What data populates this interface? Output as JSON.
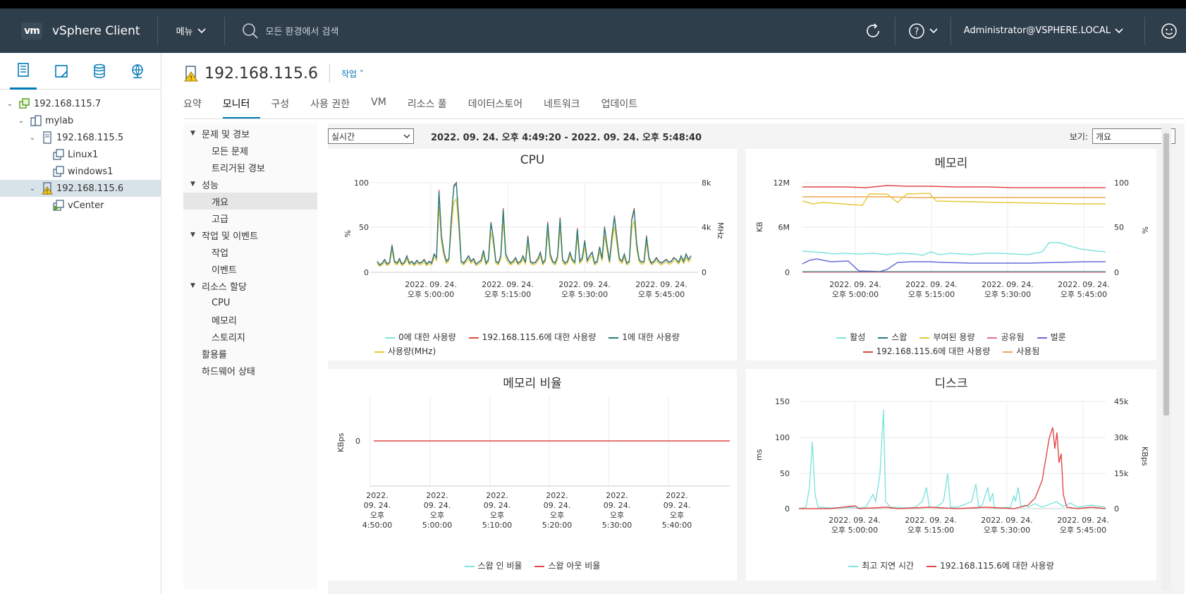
{
  "header": {
    "logo": "vm",
    "app_title": "vSphere Client",
    "menu_label": "메뉴",
    "search_placeholder": "모든 환경에서 검색",
    "user": "Administrator@VSPHERE.LOCAL"
  },
  "left_tabs": [
    "hosts-clusters-icon",
    "vms-templates-icon",
    "storage-icon",
    "networking-icon"
  ],
  "tree": [
    {
      "label": "192.168.115.7",
      "level": 0,
      "icon": "vcenter-icon",
      "expanded": true
    },
    {
      "label": "mylab",
      "level": 1,
      "icon": "datacenter-icon",
      "expanded": true
    },
    {
      "label": "192.168.115.5",
      "level": 2,
      "icon": "host-icon",
      "expanded": true
    },
    {
      "label": "Linux1",
      "level": 3,
      "icon": "vm-icon"
    },
    {
      "label": "windows1",
      "level": 3,
      "icon": "vm-icon"
    },
    {
      "label": "192.168.115.6",
      "level": 2,
      "icon": "host-warning-icon",
      "expanded": true,
      "selected": true
    },
    {
      "label": "vCenter",
      "level": 3,
      "icon": "vm-running-icon"
    }
  ],
  "page": {
    "title": "192.168.115.6",
    "actions_label": "작업",
    "tabs": [
      "요약",
      "모니터",
      "구성",
      "사용 권한",
      "VM",
      "리소스 풀",
      "데이터스토어",
      "네트워크",
      "업데이트"
    ],
    "active_tab": "모니터"
  },
  "subnav": [
    {
      "label": "문제 및 경보",
      "type": "group"
    },
    {
      "label": "모든 문제",
      "type": "child"
    },
    {
      "label": "트리거된 경보",
      "type": "child"
    },
    {
      "label": "성능",
      "type": "group"
    },
    {
      "label": "개요",
      "type": "child",
      "selected": true
    },
    {
      "label": "고급",
      "type": "child"
    },
    {
      "label": "작업 및 이벤트",
      "type": "group"
    },
    {
      "label": "작업",
      "type": "child"
    },
    {
      "label": "이벤트",
      "type": "child"
    },
    {
      "label": "리소스 할당",
      "type": "group"
    },
    {
      "label": "CPU",
      "type": "child"
    },
    {
      "label": "메모리",
      "type": "child"
    },
    {
      "label": "스토리지",
      "type": "child"
    },
    {
      "label": "활용률",
      "type": "plain"
    },
    {
      "label": "하드웨어 상태",
      "type": "plain"
    }
  ],
  "toolbar": {
    "period": "실시간",
    "range": "2022. 09. 24. 오후 4:49:20 - 2022. 09. 24. 오후 5:48:40",
    "view_label": "보기:",
    "view_value": "개요"
  },
  "colors": {
    "header_bg": "#2f3e4b",
    "accent": "#0079b8",
    "teal_light": "#7fe3e0",
    "teal_dark": "#2b7b7b",
    "yellow": "#e6c93a",
    "red": "#e04848",
    "orange": "#f0a552",
    "purple": "#6a6adc",
    "pink": "#e8708a"
  },
  "chart_data": [
    {
      "type": "line",
      "title": "CPU",
      "ylabel": "%",
      "y2label": "MHz",
      "ylim": [
        0,
        100
      ],
      "yticks": [
        "100",
        "50",
        "0"
      ],
      "y2ticks": [
        "8k",
        "4k",
        "0"
      ],
      "xticks": [
        [
          "2022. 09. 24.",
          "오후 5:00:00"
        ],
        [
          "2022. 09. 24.",
          "오후 5:15:00"
        ],
        [
          "2022. 09. 24.",
          "오후 5:30:00"
        ],
        [
          "2022. 09. 24.",
          "오후 5:45:00"
        ]
      ],
      "series": [
        {
          "name": "0에 대한 사용량",
          "color": "#7fe3e0"
        },
        {
          "name": "192.168.115.6에 대한 사용량",
          "color": "#e04848"
        },
        {
          "name": "1에 대한 사용량",
          "color": "#2b7b7b"
        },
        {
          "name": "사용량(MHz)",
          "color": "#e6c93a"
        }
      ],
      "values": [
        12,
        8,
        10,
        14,
        9,
        11,
        30,
        12,
        10,
        15,
        9,
        11,
        18,
        10,
        12,
        9,
        13,
        10,
        11,
        14,
        9,
        12,
        10,
        20,
        16,
        90,
        40,
        22,
        12,
        15,
        60,
        95,
        100,
        60,
        12,
        10,
        14,
        18,
        12,
        15,
        9,
        11,
        13,
        24,
        10,
        14,
        55,
        38,
        12,
        10,
        18,
        70,
        20,
        14,
        10,
        12,
        16,
        10,
        12,
        18,
        11,
        40,
        12,
        10,
        11,
        15,
        22,
        10,
        14,
        55,
        20,
        12,
        10,
        18,
        60,
        14,
        10,
        12,
        22,
        14,
        11,
        48,
        12,
        16,
        35,
        13,
        18,
        22,
        10,
        12,
        28,
        15,
        50,
        30,
        12,
        40,
        62,
        38,
        15,
        12,
        20,
        10,
        12,
        58,
        70,
        32,
        14,
        11,
        12,
        40,
        16,
        10,
        12,
        16,
        12,
        10,
        12,
        14,
        11,
        12,
        16,
        14,
        11,
        18,
        12,
        20,
        14,
        18
      ]
    },
    {
      "type": "line",
      "title": "메모리",
      "ylabel": "KB",
      "y2label": "%",
      "yticks": [
        "12M",
        "6M",
        "0"
      ],
      "y2ticks": [
        "100",
        "50",
        "0"
      ],
      "xticks": [
        [
          "2022. 09. 24.",
          "오후 5:00:00"
        ],
        [
          "2022. 09. 24.",
          "오후 5:15:00"
        ],
        [
          "2022. 09. 24.",
          "오후 5:30:00"
        ],
        [
          "2022. 09. 24.",
          "오후 5:45:00"
        ]
      ],
      "series": [
        {
          "name": "활성",
          "color": "#7fe3e0"
        },
        {
          "name": "스왑",
          "color": "#2b7b7b"
        },
        {
          "name": "부여된 용량",
          "color": "#e6c93a"
        },
        {
          "name": "공유됨",
          "color": "#e8708a"
        },
        {
          "name": "벌룬",
          "color": "#6a6adc"
        },
        {
          "name": "192.168.115.6에 대한 사용량",
          "color": "#e04848"
        },
        {
          "name": "사용됨",
          "color": "#f0a552"
        }
      ]
    },
    {
      "type": "line",
      "title": "메모리 비율",
      "ylabel": "KBps",
      "yticks": [
        "0"
      ],
      "xticks": [
        [
          "2022.",
          "09. 24.",
          "오후",
          "4:50:00"
        ],
        [
          "2022.",
          "09. 24.",
          "오후",
          "5:00:00"
        ],
        [
          "2022.",
          "09. 24.",
          "오후",
          "5:10:00"
        ],
        [
          "2022.",
          "09. 24.",
          "오후",
          "5:20:00"
        ],
        [
          "2022.",
          "09. 24.",
          "오후",
          "5:30:00"
        ],
        [
          "2022.",
          "09. 24.",
          "오후",
          "5:40:00"
        ]
      ],
      "series": [
        {
          "name": "스왑 인 비율",
          "color": "#7fe3e0",
          "values": [
            0,
            0
          ]
        },
        {
          "name": "스왑 아웃 비율",
          "color": "#e04848",
          "values": [
            0,
            0
          ]
        }
      ]
    },
    {
      "type": "line",
      "title": "디스크",
      "ylabel": "ms",
      "y2label": "KBps",
      "yticks": [
        "150",
        "100",
        "50",
        "0"
      ],
      "y2ticks": [
        "45k",
        "30k",
        "15k",
        "0"
      ],
      "xticks": [
        [
          "2022. 09. 24.",
          "오후 5:00:00"
        ],
        [
          "2022. 09. 24.",
          "오후 5:15:00"
        ],
        [
          "2022. 09. 24.",
          "오후 5:30:00"
        ],
        [
          "2022. 09. 24.",
          "오후 5:45:00"
        ]
      ],
      "series": [
        {
          "name": "최고 지연 시간",
          "color": "#7fe3e0"
        },
        {
          "name": "192.168.115.6에 대한 사용량",
          "color": "#e04848"
        }
      ]
    }
  ]
}
